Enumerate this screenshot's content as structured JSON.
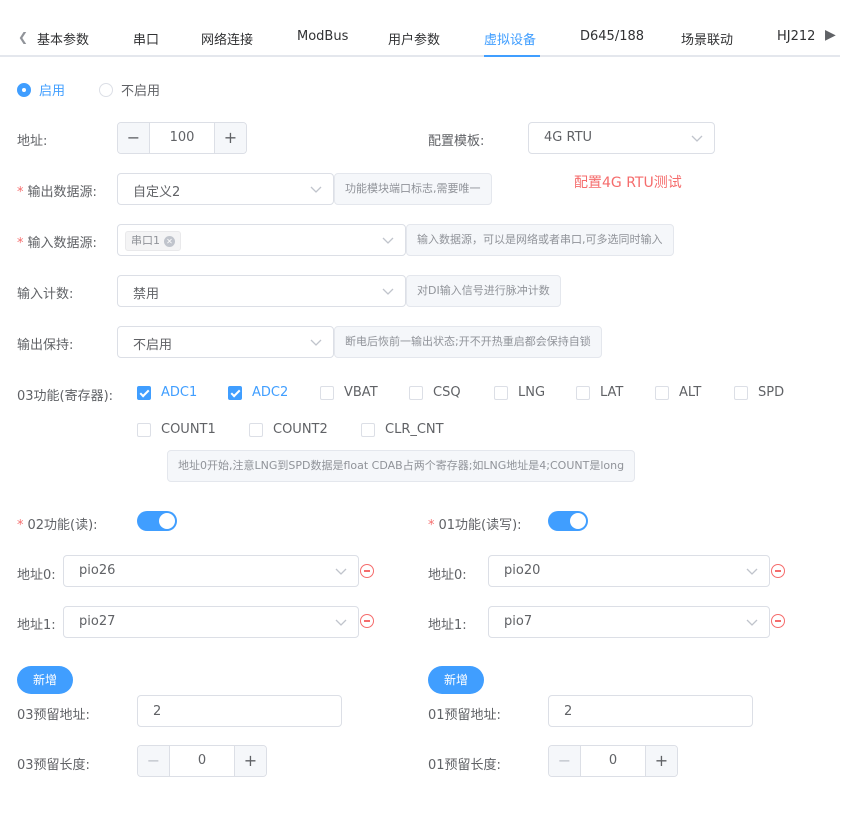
{
  "tabs": {
    "items": [
      "基本参数",
      "串口",
      "网络连接",
      "ModBus",
      "用户参数",
      "虚拟设备",
      "D645/188",
      "场景联动",
      "HJ212"
    ],
    "active": "虚拟设备"
  },
  "enable": {
    "on_label": "启用",
    "off_label": "不启用",
    "selected": "启用"
  },
  "address": {
    "label": "地址:",
    "value": "100"
  },
  "template": {
    "label": "配置模板:",
    "value": "4G RTU",
    "note": "配置4G RTU测试"
  },
  "output_source": {
    "label": "输出数据源:",
    "value": "自定义2",
    "hint": "功能模块端口标志,需要唯一"
  },
  "input_source": {
    "label": "输入数据源:",
    "tag": "串口1",
    "hint": "输入数据源，可以是网络或者串口,可多选同时输入"
  },
  "input_count": {
    "label": "输入计数:",
    "value": "禁用",
    "hint": "对DI输入信号进行脉冲计数"
  },
  "output_hold": {
    "label": "输出保持:",
    "value": "不启用",
    "hint": "断电后恢前一输出状态;开不开热重启都会保持自锁"
  },
  "func03": {
    "label": "03功能(寄存器):",
    "options": [
      {
        "label": "ADC1",
        "checked": true
      },
      {
        "label": "ADC2",
        "checked": true
      },
      {
        "label": "VBAT",
        "checked": false
      },
      {
        "label": "CSQ",
        "checked": false
      },
      {
        "label": "LNG",
        "checked": false
      },
      {
        "label": "LAT",
        "checked": false
      },
      {
        "label": "ALT",
        "checked": false
      },
      {
        "label": "SPD",
        "checked": false
      },
      {
        "label": "COUNT1",
        "checked": false
      },
      {
        "label": "COUNT2",
        "checked": false
      },
      {
        "label": "CLR_CNT",
        "checked": false
      }
    ],
    "hint": "地址0开始,注意LNG到SPD数据是float CDAB占两个寄存器;如LNG地址是4;COUNT是long"
  },
  "func02": {
    "label": "02功能(读):",
    "enabled": true,
    "addr0_label": "地址0:",
    "addr0_value": "pio26",
    "addr1_label": "地址1:",
    "addr1_value": "pio27",
    "add_label": "新增",
    "reserve_addr_label": "03预留地址:",
    "reserve_addr_value": "2",
    "reserve_len_label": "03预留长度:",
    "reserve_len_value": "0"
  },
  "func01": {
    "label": "01功能(读写):",
    "enabled": true,
    "addr0_label": "地址0:",
    "addr0_value": "pio20",
    "addr1_label": "地址1:",
    "addr1_value": "pio7",
    "add_label": "新增",
    "reserve_addr_label": "01预留地址:",
    "reserve_addr_value": "2",
    "reserve_len_label": "01预留长度:",
    "reserve_len_value": "0"
  },
  "colors": {
    "primary": "#409eff",
    "danger": "#f56c6c"
  }
}
